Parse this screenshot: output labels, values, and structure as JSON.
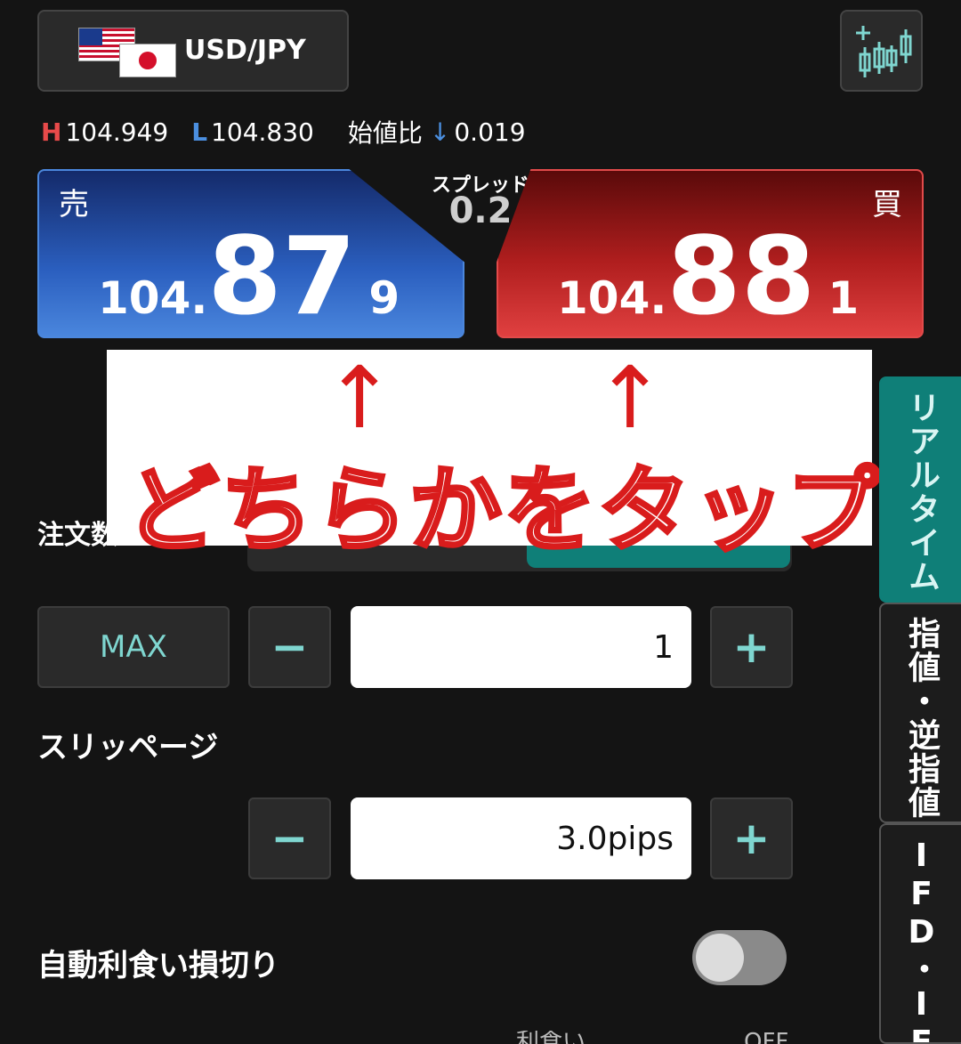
{
  "header": {
    "pair_label": "USD/JPY",
    "base_flag": "us-flag-icon",
    "quote_flag": "jp-flag-icon",
    "chart_icon": "candlestick-chart-icon"
  },
  "stats": {
    "high_marker": "H",
    "high_value": "104.949",
    "low_marker": "L",
    "low_value": "104.830",
    "change_label": "始値比",
    "change_arrow": "↓",
    "change_value": "0.019"
  },
  "spread": {
    "label": "スプレッド",
    "value": "0.2"
  },
  "sell": {
    "side": "売",
    "price_prefix": "104.",
    "price_main": "87",
    "price_tail": "9",
    "color": "#2b5fbf"
  },
  "buy": {
    "side": "買",
    "price_prefix": "104.",
    "price_main": "88",
    "price_tail": "1",
    "color": "#b01e1e"
  },
  "annotation": {
    "arrow": "↑",
    "text": "どちらかをタップ",
    "color": "#d91c1c"
  },
  "order": {
    "label": "注文数",
    "max_label": "MAX",
    "minus": "−",
    "plus": "+",
    "quantity": "1"
  },
  "slippage": {
    "label": "スリッページ",
    "minus": "−",
    "plus": "+",
    "value": "3.0pips"
  },
  "auto": {
    "label": "自動利食い損切り",
    "toggle_on": false
  },
  "bottom": {
    "partial_label": "利食い",
    "partial_value": "OFF"
  },
  "side_tabs": [
    {
      "label": "リアルタイム",
      "active": true
    },
    {
      "label": "指値・逆指値",
      "active": false
    },
    {
      "label": "IFD・IFO",
      "active": false
    }
  ],
  "colors": {
    "accent": "#0f7f78",
    "background": "#141414"
  }
}
